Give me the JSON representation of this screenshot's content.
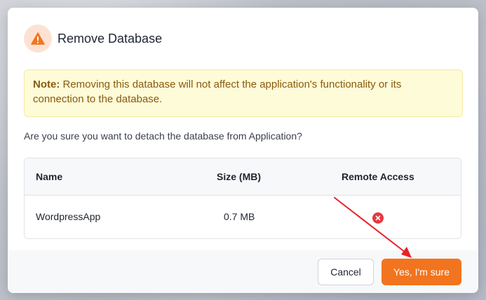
{
  "dialog": {
    "title": "Remove Database",
    "note_label": "Note:",
    "note_text": " Removing this database will not affect the application's functionality or its connection to the database.",
    "question": "Are you sure you want to detach the database from Application?"
  },
  "table": {
    "headers": [
      "Name",
      "Size (MB)",
      "Remote Access"
    ],
    "rows": [
      {
        "name": "WordpressApp",
        "size": "0.7 MB",
        "remote_access": "disabled"
      }
    ]
  },
  "buttons": {
    "cancel_label": "Cancel",
    "confirm_label": "Yes, I'm sure"
  },
  "icons": {
    "warning": "warning-icon",
    "remote_access_status": "close-circle-icon"
  },
  "colors": {
    "accent": "#f3741e",
    "warning_bg": "#fde2d4",
    "note_bg": "#fefbd8",
    "note_text": "#8a5a0a",
    "danger": "#e5393f",
    "annotation_arrow": "#e8222a"
  }
}
